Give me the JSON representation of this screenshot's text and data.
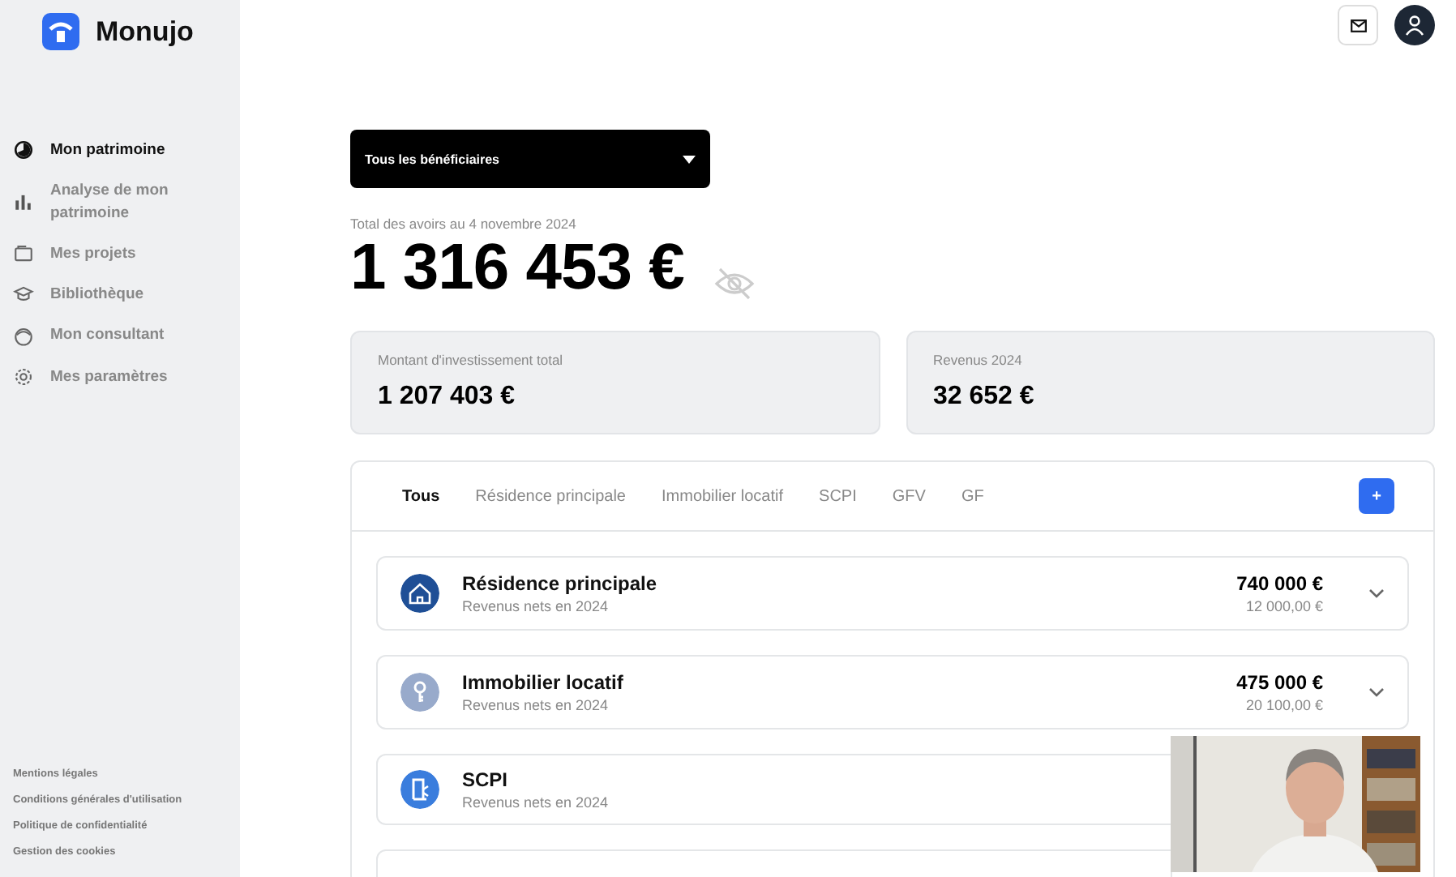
{
  "brand": {
    "name": "Monujo"
  },
  "sidebar": {
    "items": [
      {
        "label": "Mon patrimoine",
        "selected": true
      },
      {
        "label": "Analyse de mon patrimoine",
        "selected": false
      },
      {
        "label": "Mes projets",
        "selected": false
      },
      {
        "label": "Bibliothèque",
        "selected": false
      },
      {
        "label": "Mon consultant",
        "selected": false
      },
      {
        "label": "Mes paramètres",
        "selected": false
      }
    ],
    "footer_links": [
      "Mentions légales",
      "Conditions générales d'utilisation",
      "Politique de confidentialité",
      "Gestion des cookies"
    ]
  },
  "beneficiary_select": {
    "value": "Tous les bénéficiaires"
  },
  "total": {
    "label": "Total des avoirs au 4 novembre 2024",
    "amount": "1 316 453 €"
  },
  "stats": [
    {
      "label": "Montant d'investissement total",
      "value": "1 207 403 €"
    },
    {
      "label": "Revenus 2024",
      "value": "32 652 €"
    }
  ],
  "tabs": [
    {
      "label": "Tous",
      "selected": true
    },
    {
      "label": "Résidence principale",
      "selected": false
    },
    {
      "label": "Immobilier locatif",
      "selected": false
    },
    {
      "label": "SCPI",
      "selected": false
    },
    {
      "label": "GFV",
      "selected": false
    },
    {
      "label": "GF",
      "selected": false
    }
  ],
  "add_button": {
    "label": "+"
  },
  "assets": [
    {
      "kind": "house",
      "color": "#1f4f96",
      "title": "Résidence principale",
      "subtitle": "Revenus nets en 2024",
      "amount": "740 000 €",
      "income": "12 000,00 €"
    },
    {
      "kind": "key",
      "color": "#98aacb",
      "title": "Immobilier locatif",
      "subtitle": "Revenus nets en 2024",
      "amount": "475 000 €",
      "income": "20 100,00 €"
    },
    {
      "kind": "building",
      "color": "#3a7ddd",
      "title": "SCPI",
      "subtitle": "Revenus nets en 2024"
    }
  ]
}
